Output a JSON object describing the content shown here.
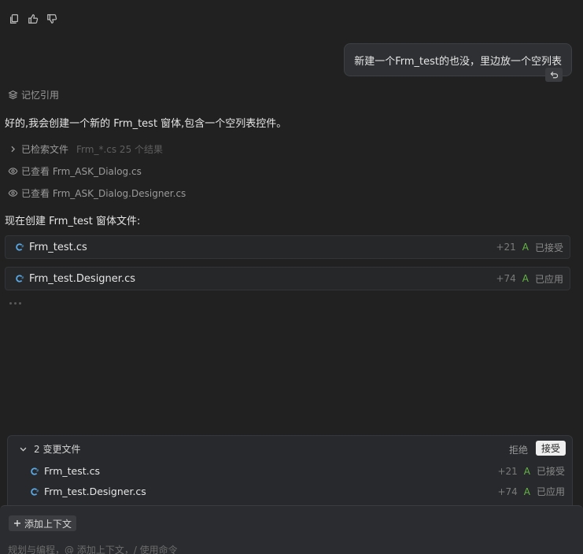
{
  "feedback": {
    "icons": [
      "copy-icon",
      "thumbs-up-icon",
      "thumbs-down-icon"
    ]
  },
  "user_message": {
    "text": "新建一个Frm_test的也没，里边放一个空列表"
  },
  "memory_ref": {
    "label": "记忆引用"
  },
  "assistant": {
    "intro": "好的,我会创建一个新的 Frm_test 窗体,包含一个空列表控件。",
    "steps": [
      {
        "label": "已检索文件",
        "detail": "Frm_*.cs 25 个结果",
        "icon": "chevron-right-icon"
      },
      {
        "label": "已查看 Frm_ASK_Dialog.cs",
        "detail": "",
        "icon": "eye-icon"
      },
      {
        "label": "已查看 Frm_ASK_Dialog.Designer.cs",
        "detail": "",
        "icon": "eye-icon"
      }
    ],
    "creating_text": "现在创建 Frm_test 窗体文件:",
    "files": [
      {
        "name": "Frm_test.cs",
        "added": "+21",
        "marker": "A",
        "status": "已接受"
      },
      {
        "name": "Frm_test.Designer.cs",
        "added": "+74",
        "marker": "A",
        "status": "已应用"
      }
    ]
  },
  "changes": {
    "title": "2 变更文件",
    "reject_label": "拒绝",
    "accept_label": "接受",
    "files": [
      {
        "name": "Frm_test.cs",
        "added": "+21",
        "marker": "A",
        "status": "已接受"
      },
      {
        "name": "Frm_test.Designer.cs",
        "added": "+74",
        "marker": "A",
        "status": "已应用"
      }
    ]
  },
  "input": {
    "add_context_label": "添加上下文",
    "placeholder": "规划与编程，@ 添加上下文，/ 使用命令"
  },
  "colors": {
    "background": "#212121",
    "csharp_icon": "#5aa9e6",
    "added_marker": "#66b547"
  }
}
